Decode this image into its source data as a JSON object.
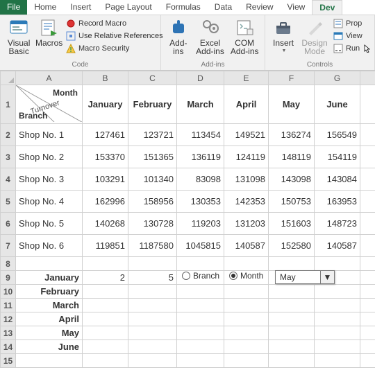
{
  "tabs": {
    "file": "File",
    "home": "Home",
    "insert": "Insert",
    "page_layout": "Page Layout",
    "formulas": "Formulas",
    "data": "Data",
    "review": "Review",
    "view": "View",
    "developer": "Dev"
  },
  "ribbon": {
    "code": {
      "label": "Code",
      "visual_basic": "Visual\nBasic",
      "macros": "Macros",
      "record_macro": "Record Macro",
      "use_relative": "Use Relative References",
      "macro_security": "Macro Security"
    },
    "addins": {
      "label": "Add-ins",
      "addins": "Add-\nins",
      "excel_addins": "Excel\nAdd-ins",
      "com_addins": "COM\nAdd-ins"
    },
    "controls": {
      "label": "Controls",
      "insert": "Insert",
      "design_mode": "Design\nMode",
      "properties": "Prop",
      "view_code": "View",
      "run_dialog": "Run"
    }
  },
  "columns": [
    "A",
    "B",
    "C",
    "D",
    "E",
    "F",
    "G"
  ],
  "a1": {
    "month": "Month",
    "branch": "Branch",
    "turnover": "Turnover"
  },
  "headers": [
    "January",
    "February",
    "March",
    "April",
    "May",
    "June"
  ],
  "rows": [
    {
      "branch": "Shop No. 1",
      "v": [
        127461,
        123721,
        113454,
        149521,
        136274,
        156549
      ]
    },
    {
      "branch": "Shop No. 2",
      "v": [
        153370,
        151365,
        136119,
        124119,
        148119,
        154119
      ]
    },
    {
      "branch": "Shop No. 3",
      "v": [
        103291,
        101340,
        83098,
        131098,
        143098,
        143084
      ]
    },
    {
      "branch": "Shop No. 4",
      "v": [
        162996,
        158956,
        130353,
        142353,
        150753,
        163953
      ]
    },
    {
      "branch": "Shop No. 5",
      "v": [
        140268,
        130728,
        119203,
        131203,
        151603,
        148723
      ]
    },
    {
      "branch": "Shop No. 6",
      "v": [
        119851,
        1187580,
        1045815,
        140587,
        152580,
        140587
      ]
    }
  ],
  "row9": {
    "a": "January",
    "b": 2,
    "c": 5,
    "radio_branch": "Branch",
    "radio_month": "Month",
    "combo": "May"
  },
  "months_col": [
    "February",
    "March",
    "April",
    "May",
    "June"
  ],
  "chart_data": {
    "type": "table",
    "title": "Monthly turnover by branch",
    "columns": [
      "January",
      "February",
      "March",
      "April",
      "May",
      "June"
    ],
    "rows": [
      "Shop No. 1",
      "Shop No. 2",
      "Shop No. 3",
      "Shop No. 4",
      "Shop No. 5",
      "Shop No. 6"
    ],
    "values": [
      [
        127461,
        123721,
        113454,
        149521,
        136274,
        156549
      ],
      [
        153370,
        151365,
        136119,
        124119,
        148119,
        154119
      ],
      [
        103291,
        101340,
        83098,
        131098,
        143098,
        143084
      ],
      [
        162996,
        158956,
        130353,
        142353,
        150753,
        163953
      ],
      [
        140268,
        130728,
        119203,
        131203,
        151603,
        148723
      ],
      [
        119851,
        1187580,
        1045815,
        140587,
        152580,
        140587
      ]
    ]
  }
}
